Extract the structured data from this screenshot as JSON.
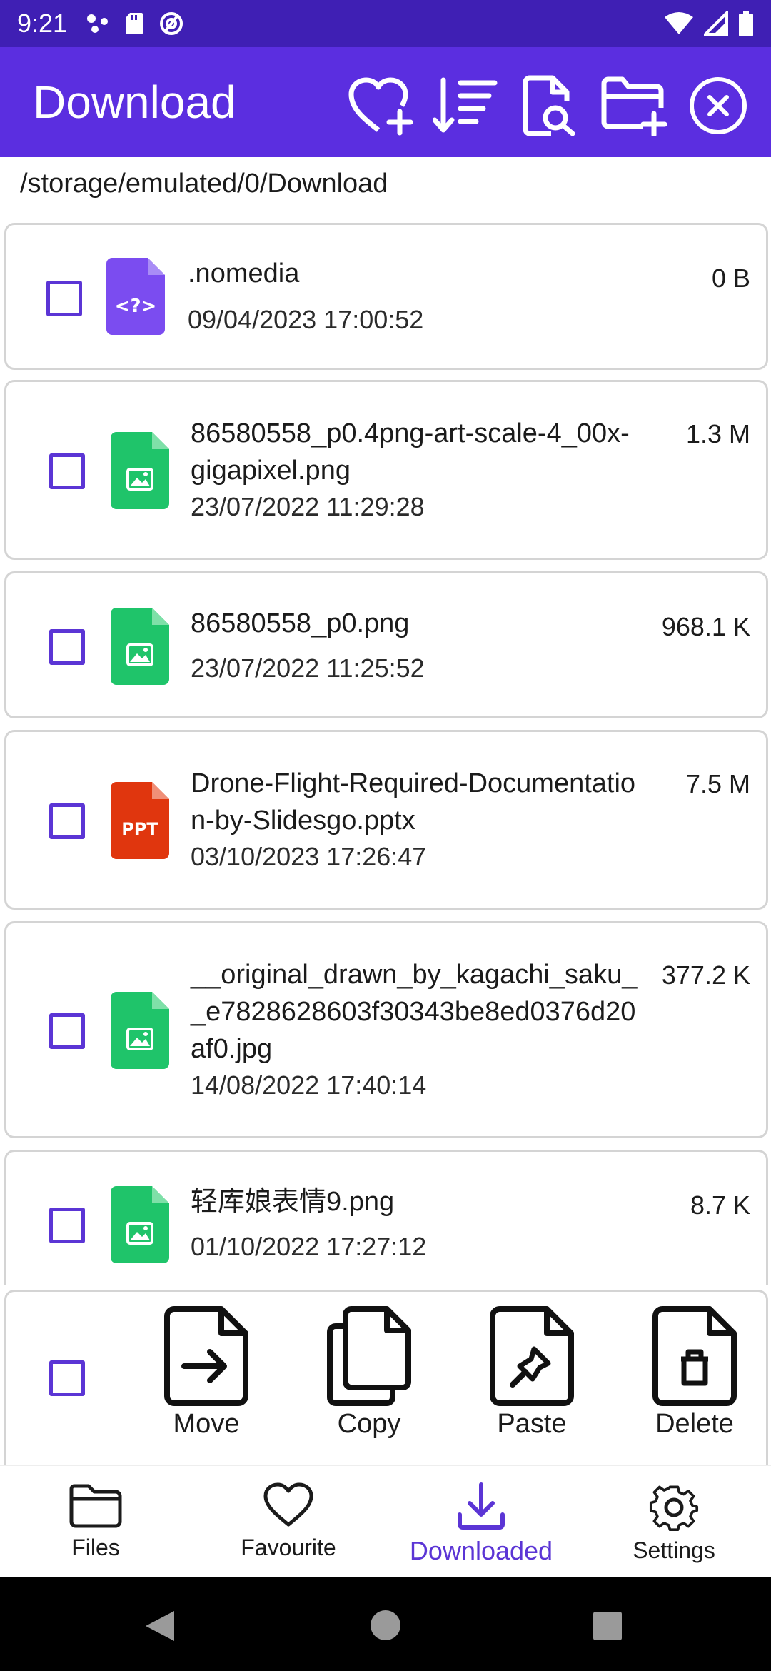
{
  "status_bar": {
    "time": "9:21"
  },
  "app_bar": {
    "title": "Download",
    "actions": [
      "heart-plus-icon",
      "sort-icon",
      "file-search-icon",
      "new-folder-icon",
      "close-circle-icon"
    ]
  },
  "path": "/storage/emulated/0/Download",
  "files": [
    {
      "name": ".nomedia",
      "date": "09/04/2023 17:00:52",
      "size": "0 B",
      "icon": "unknown-file-icon"
    },
    {
      "name": "86580558_p0.4png-art-scale-4_00x-gigapixel.png",
      "date": "23/07/2022 11:29:28",
      "size": "1.3 M",
      "icon": "image-file-icon"
    },
    {
      "name": "86580558_p0.png",
      "date": "23/07/2022 11:25:52",
      "size": "968.1 K",
      "icon": "image-file-icon"
    },
    {
      "name": "Drone-Flight-Required-Documentation-by-Slidesgo.pptx",
      "date": "03/10/2023 17:26:47",
      "size": "7.5 M",
      "icon": "ppt-file-icon",
      "badge": "PPT"
    },
    {
      "name": "__original_drawn_by_kagachi_saku__e7828628603f30343be8ed0376d20af0.jpg",
      "date": "14/08/2022 17:40:14",
      "size": "377.2 K",
      "icon": "image-file-icon"
    },
    {
      "name": "轻库娘表情9.png",
      "date": "01/10/2022 17:27:12",
      "size": "8.7 K",
      "icon": "image-file-icon"
    }
  ],
  "actions": {
    "move": "Move",
    "copy": "Copy",
    "paste": "Paste",
    "delete": "Delete"
  },
  "nav": {
    "files": "Files",
    "favourite": "Favourite",
    "downloaded": "Downloaded",
    "settings": "Settings"
  },
  "colors": {
    "app_bar": "#5b2ee0",
    "status_bar": "#3f1fb4",
    "accent": "#5b35d5",
    "image_icon": "#1fc46a",
    "ppt_icon": "#e0360e",
    "unknown_icon": "#7b4cf0"
  }
}
